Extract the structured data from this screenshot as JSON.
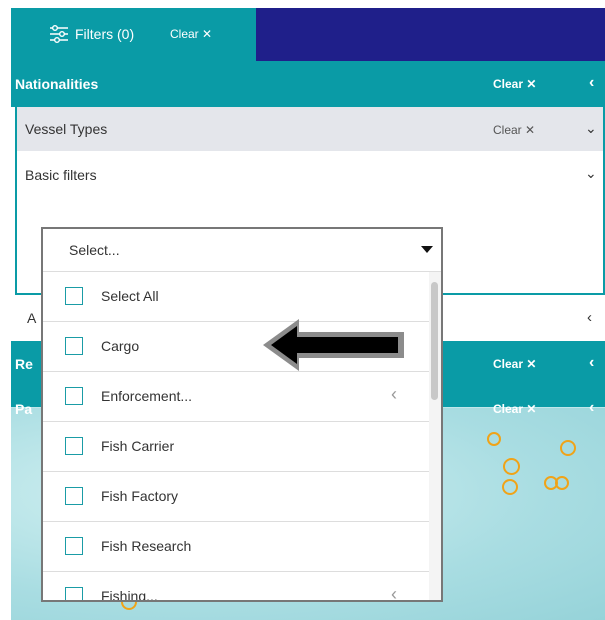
{
  "toolbar": {
    "filters_label": "Filters (0)",
    "clear_label": "Clear"
  },
  "sections": {
    "nationalities": {
      "title": "Nationalities",
      "clear": "Clear"
    },
    "vessel_types": {
      "title": "Vessel Types",
      "clear": "Clear"
    },
    "basic_filters": {
      "title": "Basic filters"
    },
    "advanced": {
      "title": "A"
    },
    "region": {
      "title": "Re",
      "clear": "Clear"
    },
    "port": {
      "title": "Pa",
      "clear": "Clear"
    }
  },
  "dropdown": {
    "placeholder": "Select...",
    "options": [
      {
        "label": "Select All"
      },
      {
        "label": "Cargo"
      },
      {
        "label": "Enforcement..."
      },
      {
        "label": "Fish Carrier"
      },
      {
        "label": "Fish Factory"
      },
      {
        "label": "Fish Research"
      },
      {
        "label": "Fishing..."
      }
    ]
  },
  "colors": {
    "teal": "#0a9ba6",
    "navy": "#1f1f8a",
    "marker": "#f0a318"
  },
  "icons": {
    "filter": "sliders-icon",
    "clear": "close-icon",
    "caret": "caret-down-icon",
    "expand": "chevron-left-icon"
  }
}
